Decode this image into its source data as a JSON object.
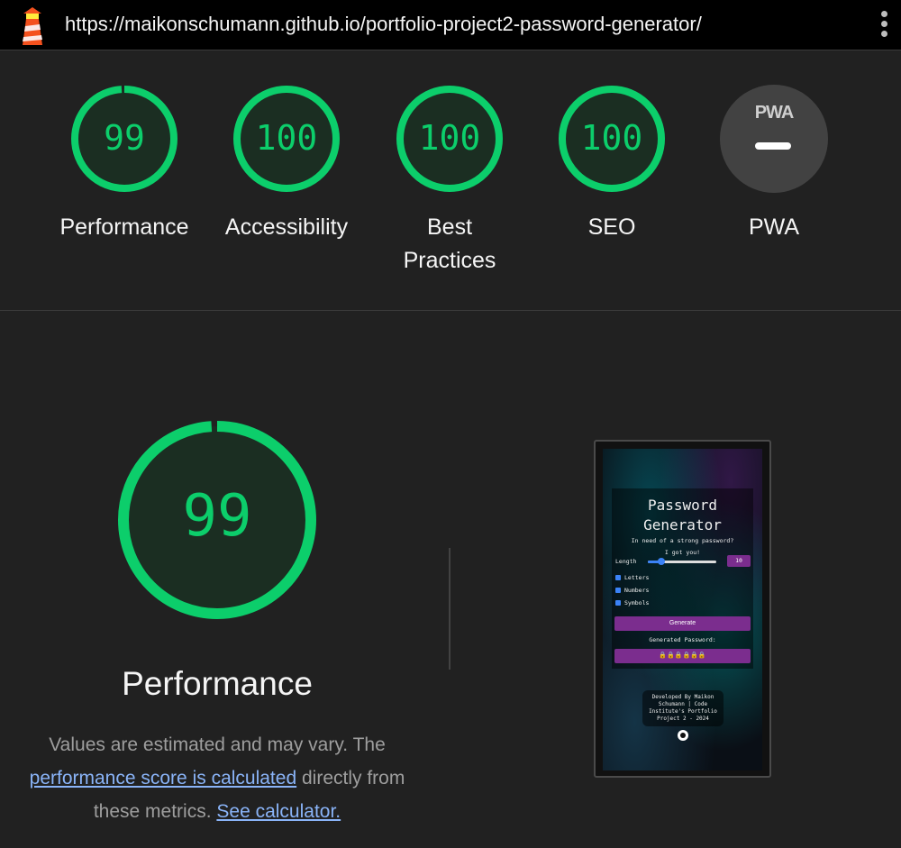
{
  "topbar": {
    "logo_icon": "lighthouse-icon",
    "url": "https://maikonschumann.github.io/portfolio-project2-password-generator/",
    "menu_icon": "kebab-menu-icon"
  },
  "colors": {
    "pass": "#0cce6b",
    "pass_fill": "#1b2e22",
    "background": "#212121",
    "link": "#8ab4f8"
  },
  "gauges": [
    {
      "score": "99",
      "value": 0.99,
      "label": "Performance"
    },
    {
      "score": "100",
      "value": 1.0,
      "label": "Accessibility"
    },
    {
      "score": "100",
      "value": 1.0,
      "label": "Best Practices"
    },
    {
      "score": "100",
      "value": 1.0,
      "label": "SEO"
    }
  ],
  "pwa": {
    "badge_text": "PWA",
    "label": "PWA",
    "icon": "pwa-badge-icon"
  },
  "detail": {
    "score": "99",
    "value": 0.99,
    "title": "Performance",
    "desc_prefix": "Values are estimated and may vary. The",
    "desc_link": "performance score is calculated",
    "desc_middle": "directly from these metrics.",
    "calc_link": "See calculator."
  },
  "screenshot": {
    "title": "Password Generator",
    "subtitle1": "In need of a strong password?",
    "subtitle2": "I got you!",
    "length_label": "Length",
    "length_value": "10",
    "length_fraction": 0.2,
    "opt_letters": "Letters",
    "opt_numbers": "Numbers",
    "opt_symbols": "Symbols",
    "generate_label": "Generate",
    "generated_label": "Generated Password:",
    "generated_value": "🔒🔒🔒🔒🔒🔒",
    "footer": "Developed By Maikon Schumann | Code Institute's Portfolio Project 2 - 2024"
  }
}
